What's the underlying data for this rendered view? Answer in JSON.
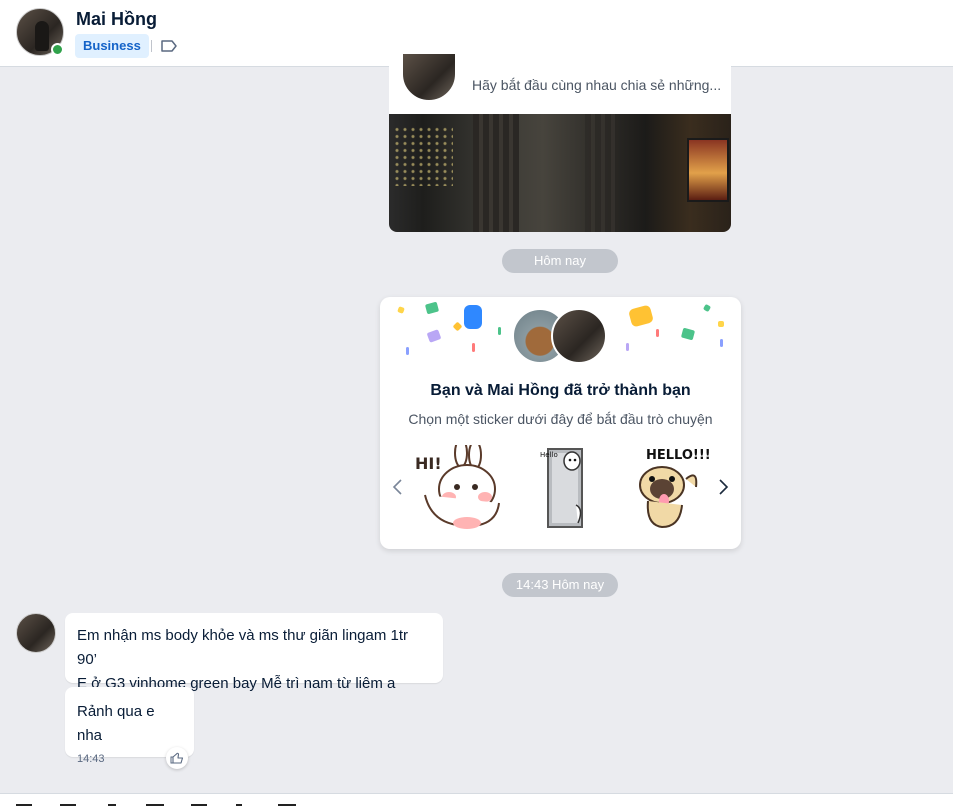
{
  "header": {
    "contact_name": "Mai Hồng",
    "badge": "Business",
    "online": true,
    "accent": "#30a24b"
  },
  "profile_card": {
    "intro_text": "Hãy bắt đầu cùng nhau chia sẻ những..."
  },
  "separators": {
    "today": "Hôm nay",
    "timestamp": "14:43 Hôm nay"
  },
  "friend_card": {
    "title": "Bạn và Mai Hồng đã trở thành bạn",
    "subtitle": "Chọn một sticker dưới đây để bắt đầu trò chuyện",
    "stickers": [
      "bunny-hi-sticker",
      "bear-hello-door-sticker",
      "pug-hello-sticker"
    ],
    "sticker_text": [
      "HI!",
      "Hello",
      "HELLO!!!"
    ]
  },
  "messages": [
    {
      "text_line1": "Em nhận ms body khỏe và ms thư giãn lingam 1tr 90’",
      "text_line2": "E ở G3 vinhome green bay Mễ trì nam từ liêm a"
    },
    {
      "text": "Rảnh qua e nha",
      "time": "14:43"
    }
  ]
}
